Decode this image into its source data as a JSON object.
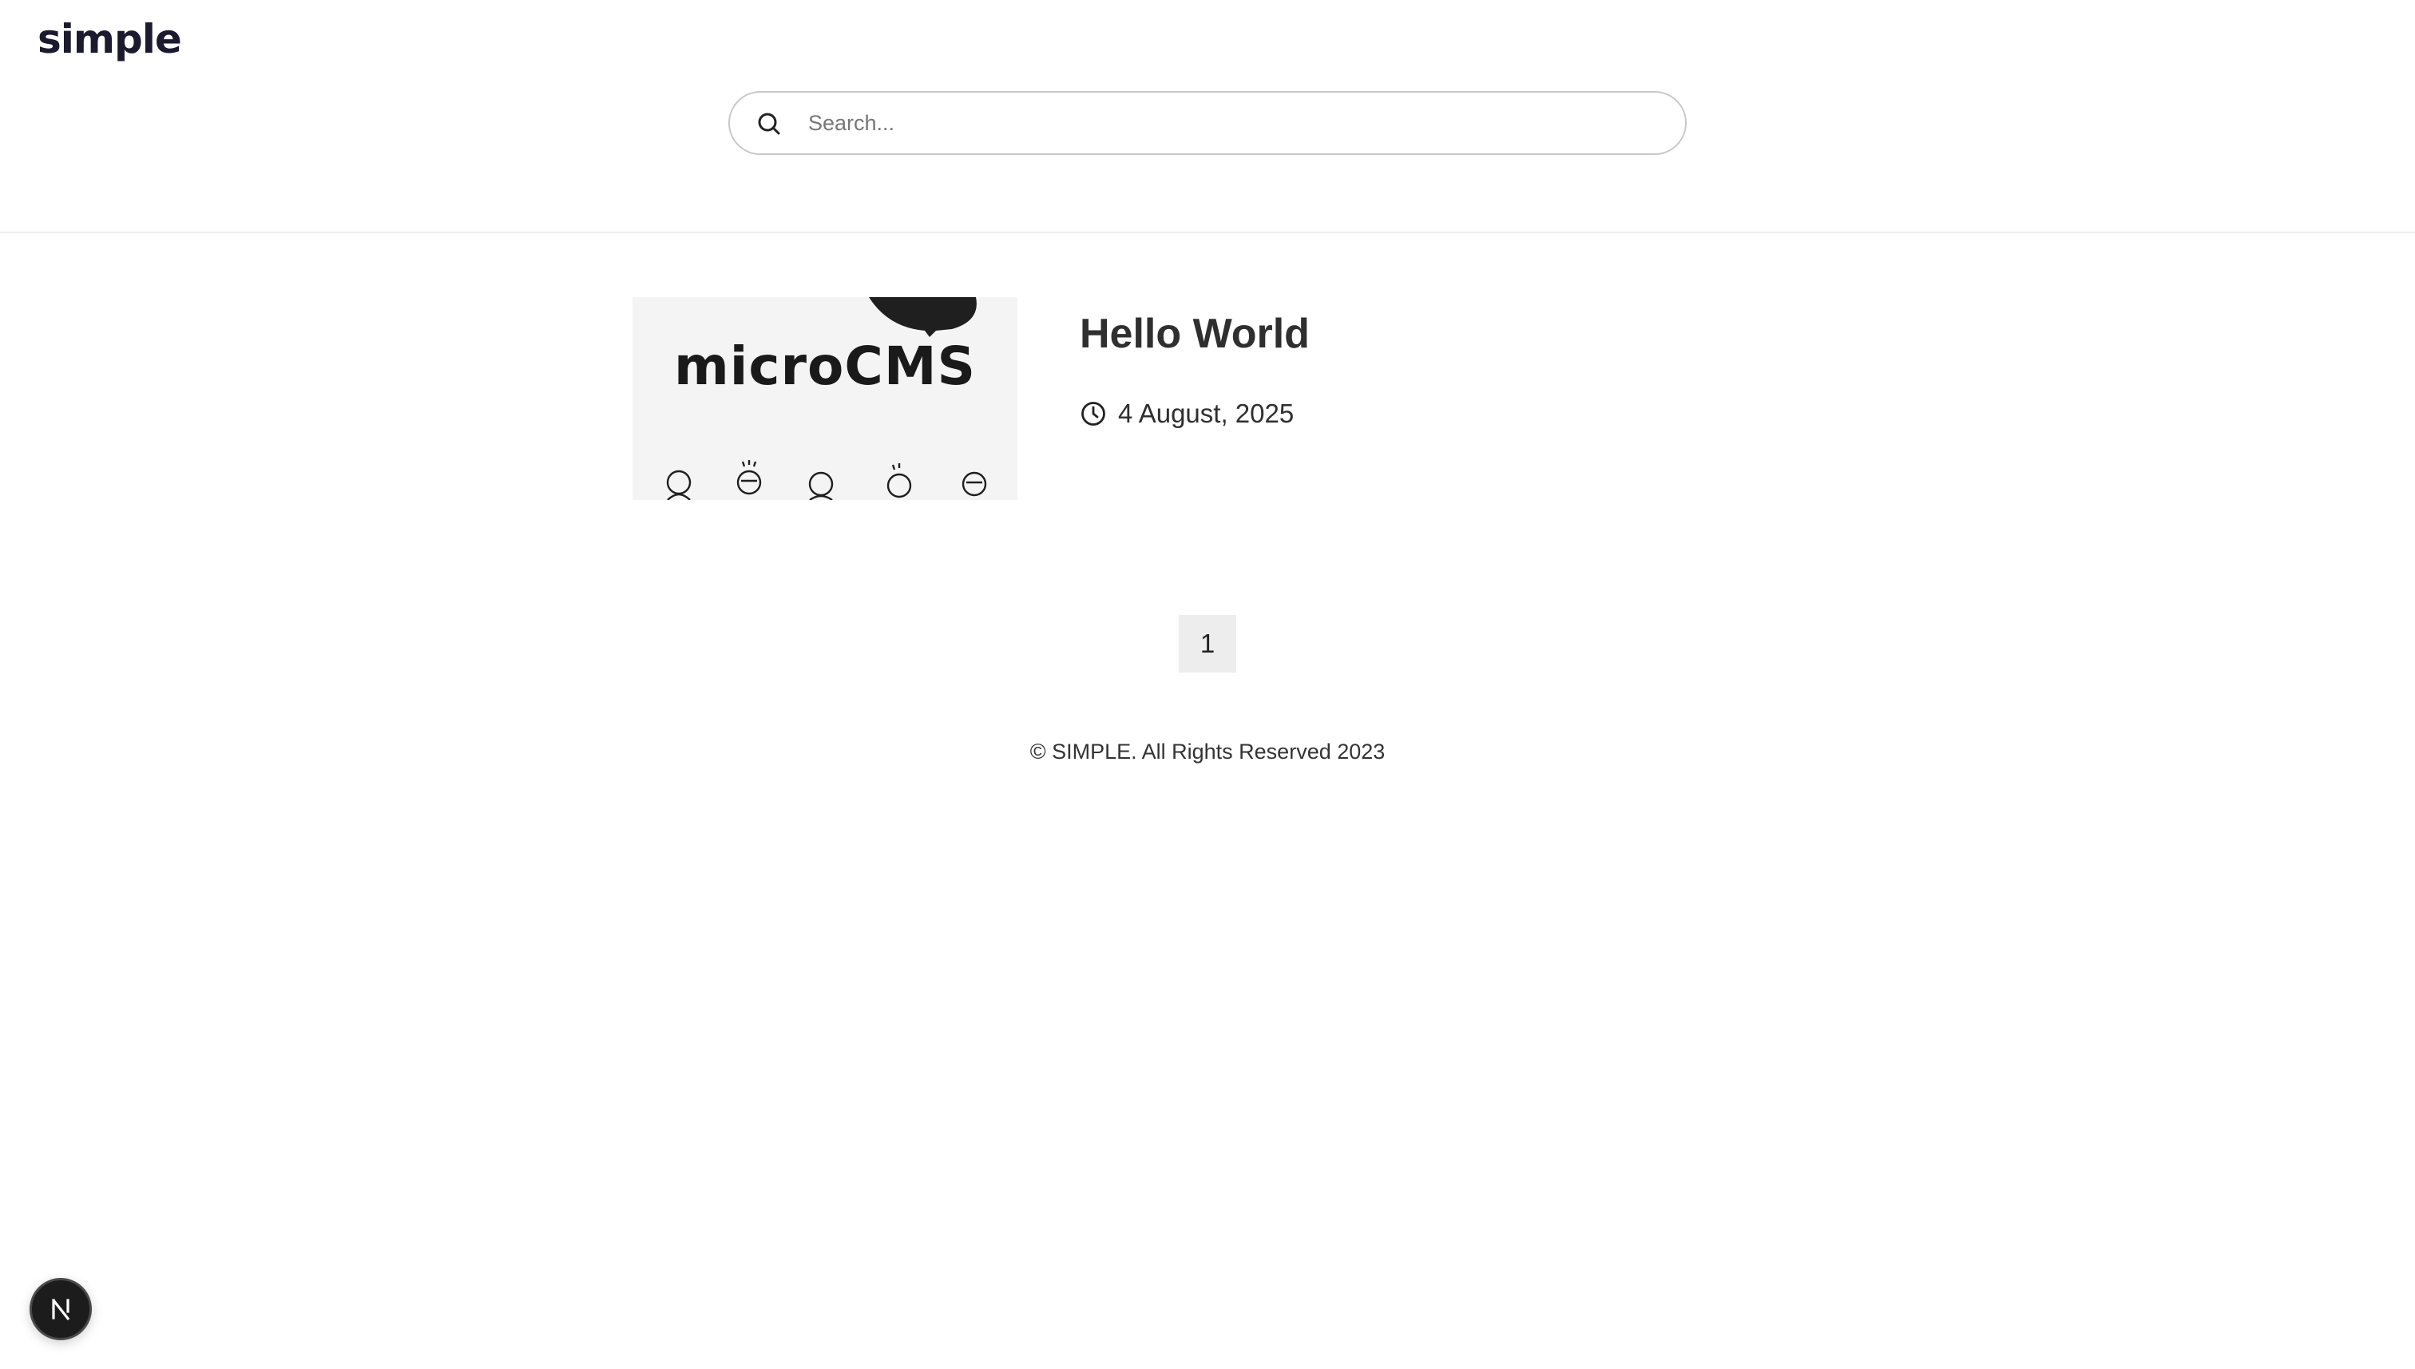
{
  "header": {
    "logo": "simple",
    "search": {
      "placeholder": "Search...",
      "value": ""
    }
  },
  "articles": [
    {
      "thumbnail_text": "microCMS",
      "title": "Hello World",
      "date": "4 August, 2025",
      "date_icon": "clock-icon"
    }
  ],
  "pagination": {
    "pages": [
      "1"
    ],
    "current": "1"
  },
  "footer": {
    "copyright": "© SIMPLE. All Rights Reserved 2023"
  },
  "dev_badge": {
    "letter": "N",
    "icon": "nextjs-icon"
  },
  "colors": {
    "logo": "#1b1a2e",
    "text": "#2f2f2f",
    "page_button_bg": "#ededed",
    "badge_bg": "#1c1c1c"
  }
}
